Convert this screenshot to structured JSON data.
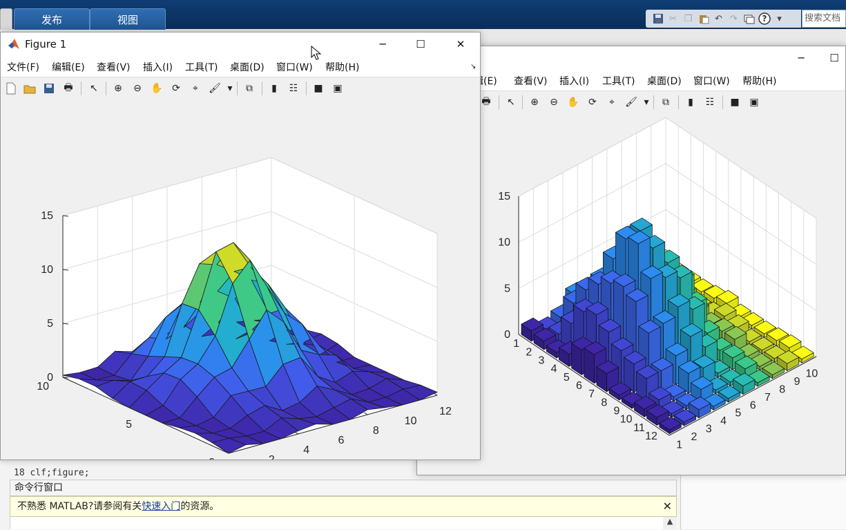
{
  "ribbon": {
    "tabs": [
      "发布",
      "视图"
    ],
    "search_placeholder": "搜索文档"
  },
  "icons": {
    "save": "save-icon",
    "cut": "cut-icon",
    "copy": "copy-icon",
    "paste": "paste-icon",
    "undo": "undo-icon",
    "redo": "redo-icon",
    "switch_windows": "switch-windows-icon",
    "help": "help-icon"
  },
  "figure1": {
    "title": "Figure 1",
    "menu": [
      "文件(F)",
      "编辑(E)",
      "查看(V)",
      "插入(I)",
      "工具(T)",
      "桌面(D)",
      "窗口(W)",
      "帮助(H)"
    ],
    "controls": {
      "minimize": "─",
      "maximize": "☐",
      "close": "✕"
    }
  },
  "figure2": {
    "menu": [
      "辑(E)",
      "查看(V)",
      "插入(I)",
      "工具(T)",
      "桌面(D)",
      "窗口(W)",
      "帮助(H)"
    ],
    "controls": {
      "minimize": "─",
      "maximize": "☐"
    }
  },
  "command_window": {
    "title": "命令行窗口",
    "banner_prefix": "不熟悉 MATLAB?请参阅有关",
    "banner_link": "快速入门",
    "banner_suffix": "的资源。",
    "close": "✕",
    "editor_line_number": "18",
    "editor_line_code": "    clf;figure;"
  },
  "chart_data": [
    {
      "type": "surface",
      "z_ticks": [
        "0",
        "5",
        "10",
        "15"
      ],
      "y_ticks": [
        "0",
        "5",
        "10"
      ],
      "x_ticks": [
        "0",
        "2",
        "4",
        "6",
        "8",
        "10",
        "12"
      ],
      "zlim": [
        0,
        15
      ],
      "grid": true,
      "colormap": [
        "#3e26a8",
        "#4358ea",
        "#2c8cf0",
        "#21b5c6",
        "#3ac98a",
        "#b5c834",
        "#f9fb15"
      ]
    },
    {
      "type": "bar3",
      "z_ticks": [
        "0",
        "5",
        "10",
        "15"
      ],
      "row_ticks": [
        "1",
        "2",
        "3",
        "4",
        "5",
        "6",
        "7",
        "8",
        "9",
        "10",
        "11",
        "12"
      ],
      "col_ticks": [
        "1",
        "2",
        "3",
        "4",
        "5",
        "6",
        "7",
        "8",
        "9",
        "10"
      ],
      "zlim": [
        0,
        15
      ],
      "grid": true,
      "colormap": [
        "#3e26a8",
        "#4358ea",
        "#2c8cf0",
        "#21b5c6",
        "#3ac98a",
        "#b5c834",
        "#f9fb15"
      ]
    }
  ]
}
